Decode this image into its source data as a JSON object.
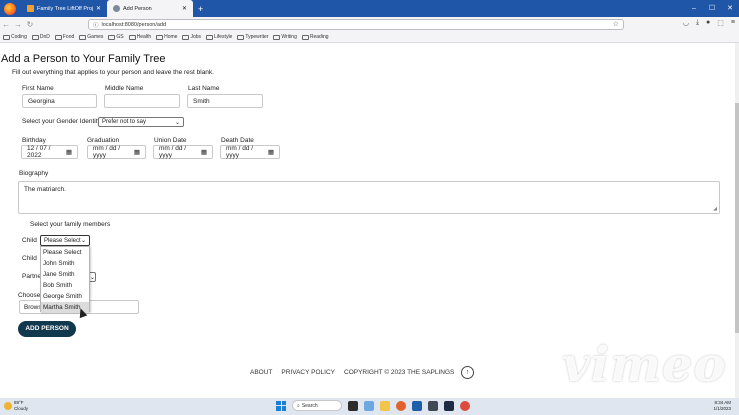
{
  "browser": {
    "tabs": [
      {
        "title": "Family Tree LiftOff Project - Go",
        "active": false
      },
      {
        "title": "Add Person",
        "active": true
      }
    ],
    "url": "localhost:8080/person/add",
    "bookmarks": [
      "Coding",
      "DnD",
      "Food",
      "Games",
      "GS",
      "Health",
      "Home",
      "Jobs",
      "Lifestyle",
      "Typewriter",
      "Writing",
      "Reading"
    ]
  },
  "page": {
    "title": "Add a Person to Your Family Tree",
    "subtitle": "Fill out everything that applies to your person and leave the rest blank.",
    "name": {
      "first_label": "First Name",
      "first_value": "Georgina",
      "middle_label": "Middle Name",
      "middle_value": "",
      "last_label": "Last Name",
      "last_value": "Smith"
    },
    "gender": {
      "label": "Select your Gender Identity",
      "value": "Prefer not to say"
    },
    "dates": {
      "birthday_label": "Birthday",
      "birthday_value": "12 / 07 / 2022",
      "graduation_label": "Graduation",
      "graduation_value": "mm / dd / yyyy",
      "union_label": "Union Date",
      "union_value": "mm / dd / yyyy",
      "death_label": "Death Date",
      "death_value": "mm / dd / yyyy"
    },
    "biography": {
      "label": "Biography",
      "value": "The matriarch."
    },
    "family": {
      "label": "Select your family members",
      "child1_label": "Child",
      "child1_value": "Please Select",
      "child2_label": "Child",
      "partner_label": "Partne",
      "options": [
        "Please Select",
        "John Smith",
        "Jane Smith",
        "Bob Smith",
        "George Smith",
        "Martha Smith"
      ]
    },
    "file": {
      "label": "Choose",
      "text": "Brows                    cted."
    },
    "submit_label": "ADD PERSON",
    "footer": [
      "ABOUT",
      "PRIVACY POLICY",
      "COPYRIGHT © 2023 THE SAPLINGS"
    ]
  },
  "watermark": "vimeo",
  "taskbar": {
    "weather_temp": "89°F",
    "weather_desc": "Cloudy",
    "search_label": "Search",
    "time": "8:34 AM",
    "date": "1/1/2023"
  }
}
